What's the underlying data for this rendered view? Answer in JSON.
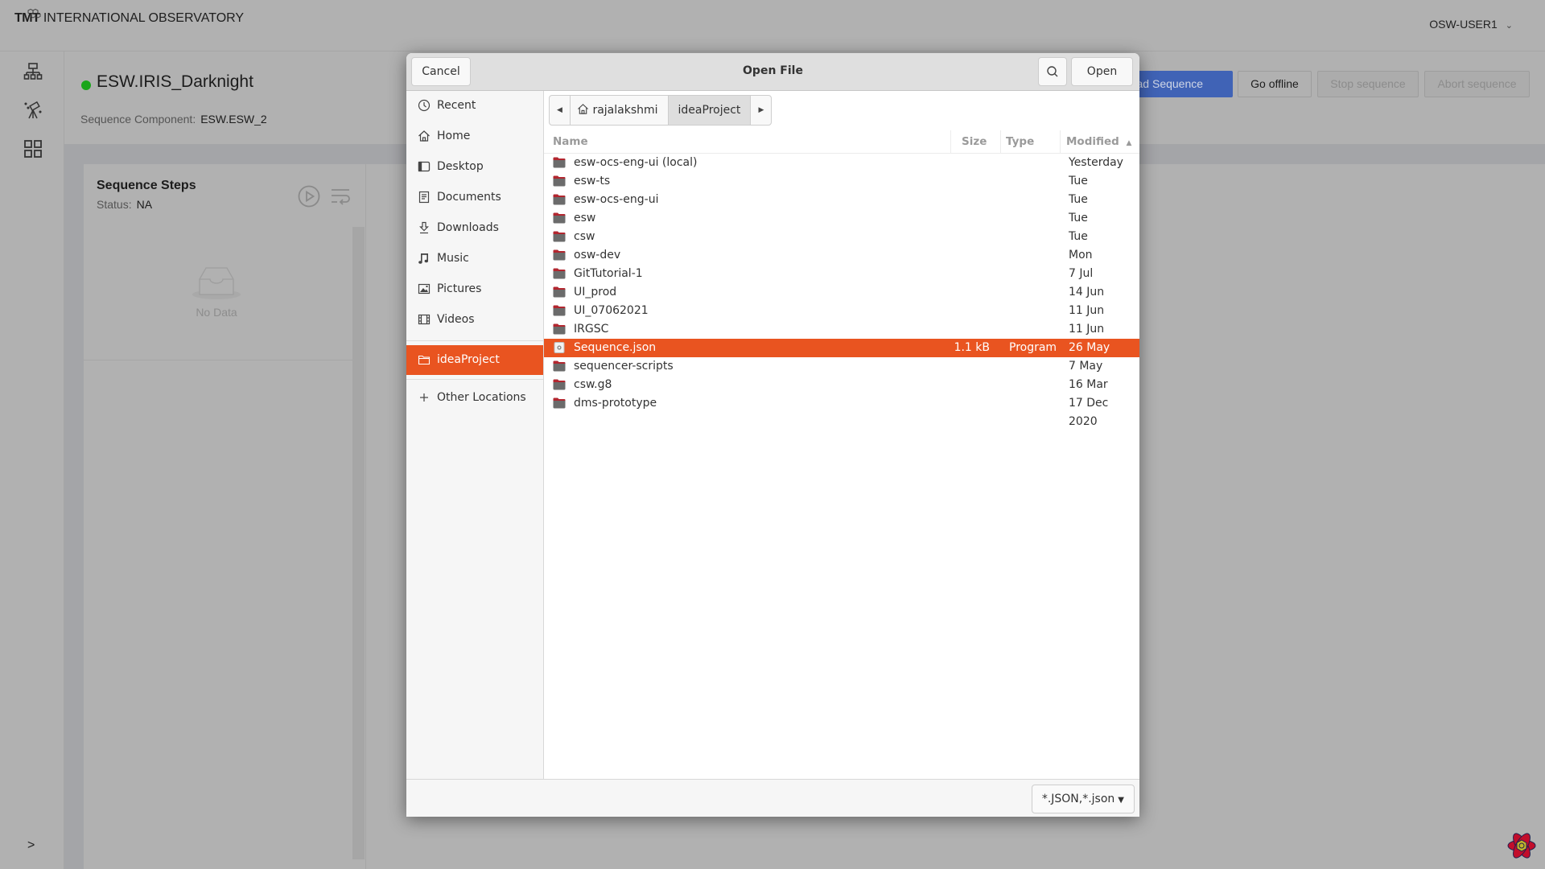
{
  "app": {
    "logo_bold": "TMT",
    "logo_text": "INTERNATIONAL OBSERVATORY",
    "user_name": "OSW-USER1"
  },
  "left_nav": {
    "items": [
      {
        "icon": "hierarchy-icon"
      },
      {
        "icon": "telescope-icon"
      },
      {
        "icon": "grid-icon"
      }
    ],
    "expand_icon": "chevron-right-icon"
  },
  "component": {
    "status_color": "#1aa51a",
    "title": "ESW.IRIS_Darknight",
    "sub_label": "Sequence Component:",
    "sub_value": "ESW.ESW_2"
  },
  "toolbar": {
    "load_label": "Load Sequence",
    "offline_label": "Go offline",
    "stop_label": "Stop sequence",
    "abort_label": "Abort sequence"
  },
  "steps_panel": {
    "title": "Sequence Steps",
    "status_label": "Status:",
    "status_value": "NA",
    "empty_text": "No Data"
  },
  "dialog": {
    "title": "Open File",
    "cancel_label": "Cancel",
    "open_label": "Open",
    "accent": "#e95420",
    "places": [
      {
        "label": "Recent",
        "icon": "clock-icon"
      },
      {
        "label": "Home",
        "icon": "home-icon"
      },
      {
        "label": "Desktop",
        "icon": "desktop-icon"
      },
      {
        "label": "Documents",
        "icon": "document-icon"
      },
      {
        "label": "Downloads",
        "icon": "download-icon"
      },
      {
        "label": "Music",
        "icon": "music-icon"
      },
      {
        "label": "Pictures",
        "icon": "picture-icon"
      },
      {
        "label": "Videos",
        "icon": "video-icon"
      }
    ],
    "bookmark": {
      "label": "ideaProject",
      "icon": "folder-icon"
    },
    "other_locations": {
      "label": "Other Locations",
      "icon": "plus-icon"
    },
    "path": [
      "rajalakshmi",
      "ideaProject"
    ],
    "columns": {
      "name": "Name",
      "size": "Size",
      "type": "Type",
      "modified": "Modified"
    },
    "files": [
      {
        "name": "esw-ocs-eng-ui (local)",
        "size": "",
        "type": "",
        "modified": "Yesterday",
        "kind": "folder"
      },
      {
        "name": "esw-ts",
        "size": "",
        "type": "",
        "modified": "Tue",
        "kind": "folder"
      },
      {
        "name": "esw-ocs-eng-ui",
        "size": "",
        "type": "",
        "modified": "Tue",
        "kind": "folder"
      },
      {
        "name": "esw",
        "size": "",
        "type": "",
        "modified": "Tue",
        "kind": "folder"
      },
      {
        "name": "csw",
        "size": "",
        "type": "",
        "modified": "Tue",
        "kind": "folder"
      },
      {
        "name": "osw-dev",
        "size": "",
        "type": "",
        "modified": "Mon",
        "kind": "folder"
      },
      {
        "name": "GitTutorial-1",
        "size": "",
        "type": "",
        "modified": "7 Jul",
        "kind": "folder"
      },
      {
        "name": "UI_prod",
        "size": "",
        "type": "",
        "modified": "14 Jun",
        "kind": "folder"
      },
      {
        "name": "UI_07062021",
        "size": "",
        "type": "",
        "modified": "11 Jun",
        "kind": "folder"
      },
      {
        "name": "IRGSC",
        "size": "",
        "type": "",
        "modified": "11 Jun",
        "kind": "folder"
      },
      {
        "name": "Sequence.json",
        "size": "1.1 kB",
        "type": "Program",
        "modified": "26 May",
        "kind": "file",
        "selected": true
      },
      {
        "name": "sequencer-scripts",
        "size": "",
        "type": "",
        "modified": "7 May",
        "kind": "folder"
      },
      {
        "name": "csw.g8",
        "size": "",
        "type": "",
        "modified": "16 Mar",
        "kind": "folder"
      },
      {
        "name": "dms-prototype",
        "size": "",
        "type": "",
        "modified": "17 Dec 2020",
        "kind": "folder"
      }
    ],
    "filter_value": "*.JSON,*.json"
  }
}
